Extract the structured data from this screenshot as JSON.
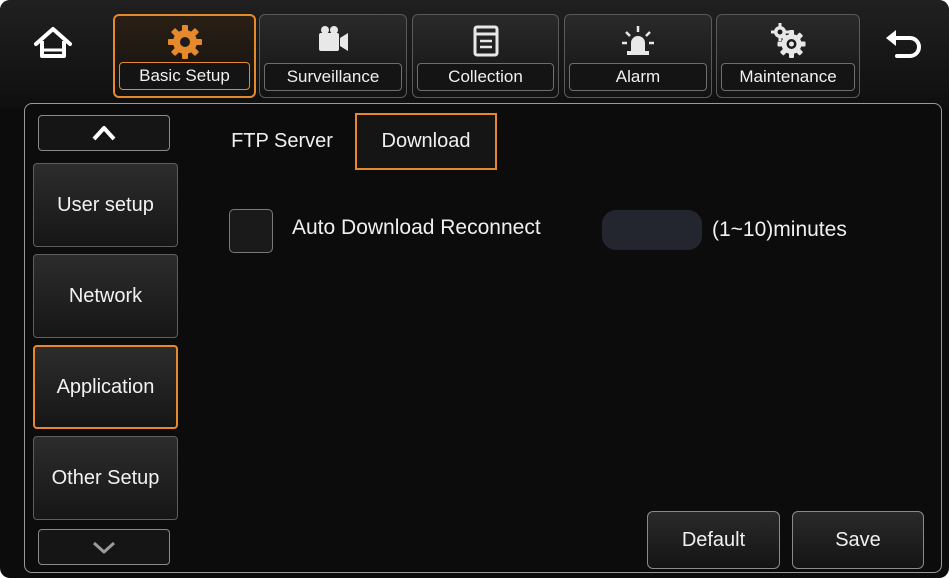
{
  "nav": {
    "tabs": [
      {
        "label": "Basic Setup",
        "icon": "gear-icon",
        "active": true
      },
      {
        "label": "Surveillance",
        "icon": "camera-icon",
        "active": false
      },
      {
        "label": "Collection",
        "icon": "document-icon",
        "active": false
      },
      {
        "label": "Alarm",
        "icon": "alarm-light-icon",
        "active": false
      },
      {
        "label": "Maintenance",
        "icon": "gears-icon",
        "active": false
      }
    ]
  },
  "sidebar": {
    "items": [
      {
        "label": "User setup",
        "active": false
      },
      {
        "label": "Network",
        "active": false
      },
      {
        "label": "Application",
        "active": true
      },
      {
        "label": "Other Setup",
        "active": false
      }
    ]
  },
  "subtabs": [
    {
      "label": "FTP Server",
      "active": false
    },
    {
      "label": "Download",
      "active": true
    }
  ],
  "form": {
    "auto_reconnect_label": "Auto Download Reconnect",
    "auto_reconnect_checked": false,
    "reconnect_minutes_value": "",
    "range_text": "(1~10)minutes"
  },
  "actions": {
    "default_label": "Default",
    "save_label": "Save"
  },
  "colors": {
    "accent": "#e5892c",
    "background": "#0c0c0c",
    "input_bg": "#24262f"
  }
}
